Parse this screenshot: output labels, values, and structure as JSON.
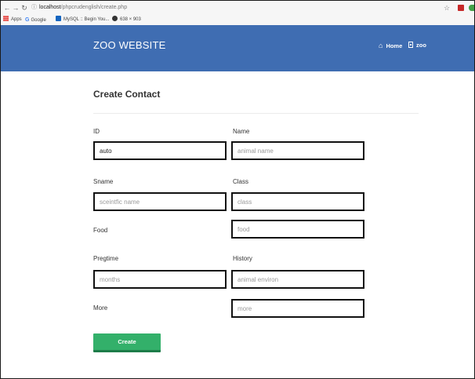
{
  "browser": {
    "url_host": "localhost",
    "url_path": "/phpcrudenglish/create.php",
    "bookmarks": [
      {
        "icon": "apps-grid-icon",
        "label": "Apps"
      },
      {
        "icon": "google-icon",
        "label": "Google"
      },
      {
        "icon": "mysql-icon",
        "label": "MySQL :: Begin You..."
      },
      {
        "icon": "dimension-icon",
        "label": "638 × 903"
      }
    ]
  },
  "navbar": {
    "brand": "ZOO WEBSITE",
    "links": [
      {
        "icon": "home-icon",
        "label": "Home"
      },
      {
        "icon": "book-icon",
        "label": "zoo"
      }
    ],
    "color": "#3f6db2"
  },
  "page": {
    "title": "Create Contact"
  },
  "form": {
    "id": {
      "label": "ID",
      "value": "auto",
      "placeholder": ""
    },
    "name": {
      "label": "Name",
      "value": "",
      "placeholder": "animal name"
    },
    "sname": {
      "label": "Sname",
      "value": "",
      "placeholder": "sceintfic name"
    },
    "class": {
      "label": "Class",
      "value": "",
      "placeholder": "class"
    },
    "food": {
      "label": "Food",
      "value": "",
      "placeholder": "food"
    },
    "pregtime": {
      "label": "Pregtime",
      "value": "",
      "placeholder": "months"
    },
    "history": {
      "label": "History",
      "value": "",
      "placeholder": "animal environ"
    },
    "more": {
      "label": "More",
      "value": "",
      "placeholder": "more"
    },
    "submit_label": "Create",
    "submit_color": "#33b06a"
  }
}
